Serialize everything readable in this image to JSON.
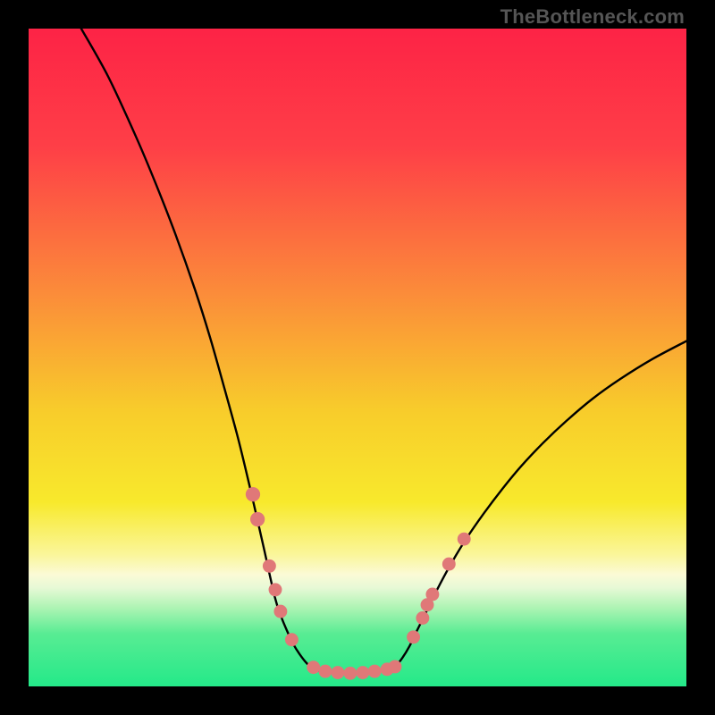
{
  "watermark": "TheBottleneck.com",
  "colors": {
    "stroke": "#000000",
    "marker": "#e07878",
    "bottom_band": "#2eea8c"
  },
  "chart_data": {
    "type": "line",
    "title": "",
    "xlabel": "",
    "ylabel": "",
    "xlim": [
      0,
      100
    ],
    "ylim": [
      0,
      100
    ],
    "notes": "Deep asymmetric V-shaped curve over a red→orange→yellow→green vertical gradient. Left arm starts near the top-left, right arm ends mid-right. Valley floor sits on the green band near the bottom. Pink dot markers cluster on both arms just above the floor and along the floor itself. Values below are proportional estimates read from pixel positions (no numeric axes present).",
    "gradient_stops": [
      {
        "pct": 0,
        "color": "#fd2346"
      },
      {
        "pct": 18,
        "color": "#fe3f47"
      },
      {
        "pct": 40,
        "color": "#fb8b3a"
      },
      {
        "pct": 58,
        "color": "#f8cc2b"
      },
      {
        "pct": 72,
        "color": "#f8e92c"
      },
      {
        "pct": 80,
        "color": "#faf69b"
      },
      {
        "pct": 83,
        "color": "#fbfad6"
      },
      {
        "pct": 85,
        "color": "#e7f9d6"
      },
      {
        "pct": 88,
        "color": "#aef4b4"
      },
      {
        "pct": 92,
        "color": "#58ec93"
      },
      {
        "pct": 100,
        "color": "#24e989"
      }
    ],
    "series": [
      {
        "name": "left-arm",
        "x": [
          8.0,
          12.1,
          16.4,
          19.3,
          22.3,
          25.3,
          27.6,
          29.8,
          31.9,
          33.8,
          35.7,
          37.4,
          38.4,
          39.4,
          40.2,
          41.2,
          42.3,
          43.3
        ],
        "y": [
          100.0,
          92.7,
          83.4,
          76.5,
          68.8,
          60.3,
          53.0,
          45.2,
          37.5,
          29.6,
          21.3,
          13.7,
          10.6,
          8.2,
          6.5,
          4.9,
          3.5,
          2.7
        ]
      },
      {
        "name": "floor",
        "x": [
          43.3,
          44.4,
          45.8,
          47.3,
          48.8,
          50.3,
          51.8,
          53.3,
          54.7,
          55.8
        ],
        "y": [
          2.7,
          2.3,
          2.1,
          2.0,
          2.0,
          2.0,
          2.1,
          2.3,
          2.6,
          3.1
        ]
      },
      {
        "name": "right-arm",
        "x": [
          55.8,
          56.8,
          57.9,
          58.8,
          60.1,
          62.1,
          64.2,
          66.5,
          69.2,
          72.0,
          74.9,
          78.2,
          81.8,
          85.7,
          89.9,
          94.9,
          100.0
        ],
        "y": [
          3.1,
          4.3,
          6.1,
          8.0,
          10.6,
          14.7,
          18.6,
          22.4,
          26.3,
          30.0,
          33.5,
          37.0,
          40.4,
          43.7,
          46.7,
          49.8,
          52.5
        ]
      }
    ],
    "markers": [
      {
        "x": 34.1,
        "y": 29.2,
        "r": 1.2
      },
      {
        "x": 34.8,
        "y": 25.4,
        "r": 1.2
      },
      {
        "x": 36.6,
        "y": 18.3,
        "r": 1.1
      },
      {
        "x": 37.5,
        "y": 14.7,
        "r": 1.1
      },
      {
        "x": 38.3,
        "y": 11.4,
        "r": 1.1
      },
      {
        "x": 40.0,
        "y": 7.1,
        "r": 1.1
      },
      {
        "x": 43.3,
        "y": 2.9,
        "r": 1.1
      },
      {
        "x": 45.1,
        "y": 2.3,
        "r": 1.1
      },
      {
        "x": 47.0,
        "y": 2.1,
        "r": 1.1
      },
      {
        "x": 48.9,
        "y": 2.0,
        "r": 1.1
      },
      {
        "x": 50.8,
        "y": 2.1,
        "r": 1.1
      },
      {
        "x": 52.6,
        "y": 2.3,
        "r": 1.1
      },
      {
        "x": 54.5,
        "y": 2.6,
        "r": 1.1
      },
      {
        "x": 55.7,
        "y": 3.0,
        "r": 1.1
      },
      {
        "x": 58.5,
        "y": 7.5,
        "r": 1.1
      },
      {
        "x": 59.9,
        "y": 10.4,
        "r": 1.1
      },
      {
        "x": 60.6,
        "y": 12.4,
        "r": 1.1
      },
      {
        "x": 61.4,
        "y": 14.0,
        "r": 1.1
      },
      {
        "x": 63.9,
        "y": 18.6,
        "r": 1.1
      },
      {
        "x": 66.2,
        "y": 22.4,
        "r": 1.1
      }
    ]
  }
}
